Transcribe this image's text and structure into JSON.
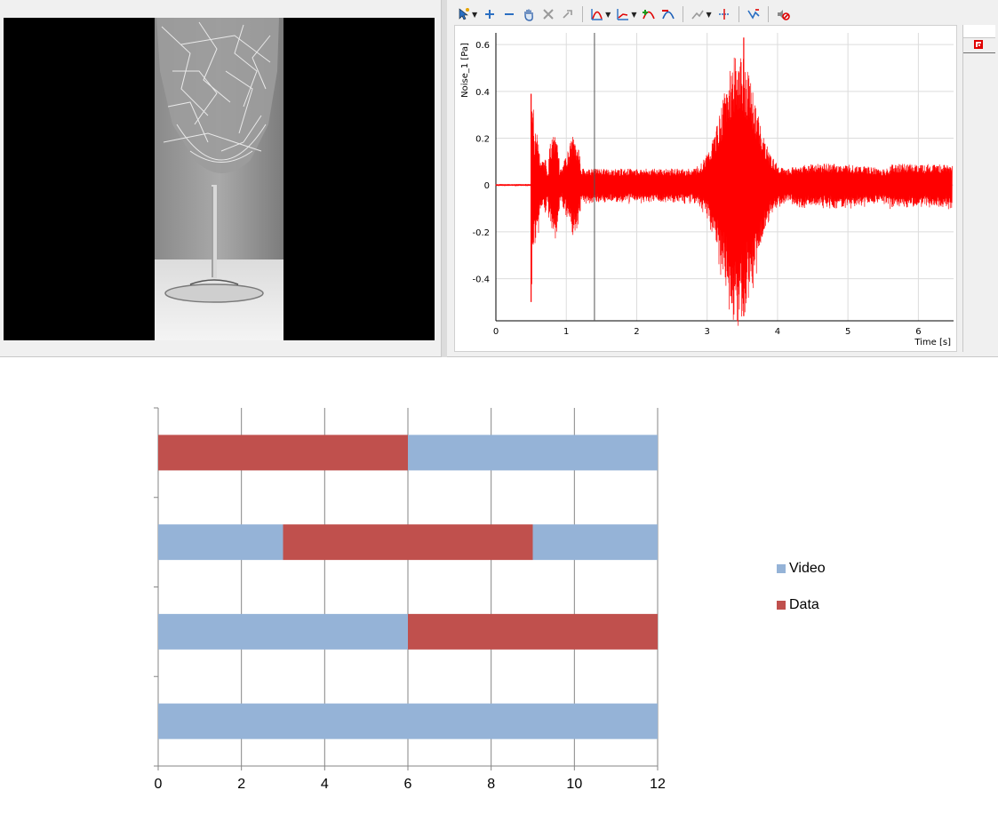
{
  "video": {
    "image": "shattered wine glass frame"
  },
  "toolbar": {
    "icons": [
      "cursor-icon",
      "zoom-in-icon",
      "zoom-out-icon",
      "pan-hand-icon",
      "cross-icon",
      "reset-icon",
      "curve-icon",
      "axis-icon",
      "add-cursor-icon",
      "remove-cursor-icon",
      "trend-icon",
      "marker-icon",
      "fit-icon",
      "mute-icon"
    ]
  },
  "signal_plot": {
    "ylabel": "Noise_1 [Pa]",
    "xlabel": "Time [s]",
    "x_ticks": [
      "0",
      "1",
      "2",
      "3",
      "4",
      "5",
      "6"
    ],
    "y_ticks": [
      "0.6",
      "0.4",
      "0.2",
      "0",
      "-0.2",
      "-0.4"
    ],
    "xlim": [
      0,
      6.5
    ],
    "ylim": [
      -0.58,
      0.65
    ],
    "cursor_time": 1.4,
    "color": "#ff0000"
  },
  "chart_data": {
    "type": "bar",
    "orientation": "horizontal",
    "stacked": true,
    "colors": {
      "Video": "#95b3d7",
      "Data": "#c0504d"
    },
    "rows": [
      {
        "segments": [
          {
            "series": "Data",
            "start": 0,
            "end": 6
          },
          {
            "series": "Video",
            "start": 6,
            "end": 12
          }
        ]
      },
      {
        "segments": [
          {
            "series": "Video",
            "start": 0,
            "end": 3
          },
          {
            "series": "Data",
            "start": 3,
            "end": 9
          },
          {
            "series": "Video",
            "start": 9,
            "end": 12
          }
        ]
      },
      {
        "segments": [
          {
            "series": "Video",
            "start": 0,
            "end": 6
          },
          {
            "series": "Data",
            "start": 6,
            "end": 12
          }
        ]
      },
      {
        "segments": [
          {
            "series": "Video",
            "start": 0,
            "end": 12
          }
        ]
      }
    ],
    "xlim": [
      0,
      12
    ],
    "x_ticks": [
      "0",
      "2",
      "4",
      "6",
      "8",
      "10",
      "12"
    ],
    "legend": {
      "position": "right",
      "items": [
        "Video",
        "Data"
      ]
    },
    "grid": true
  }
}
